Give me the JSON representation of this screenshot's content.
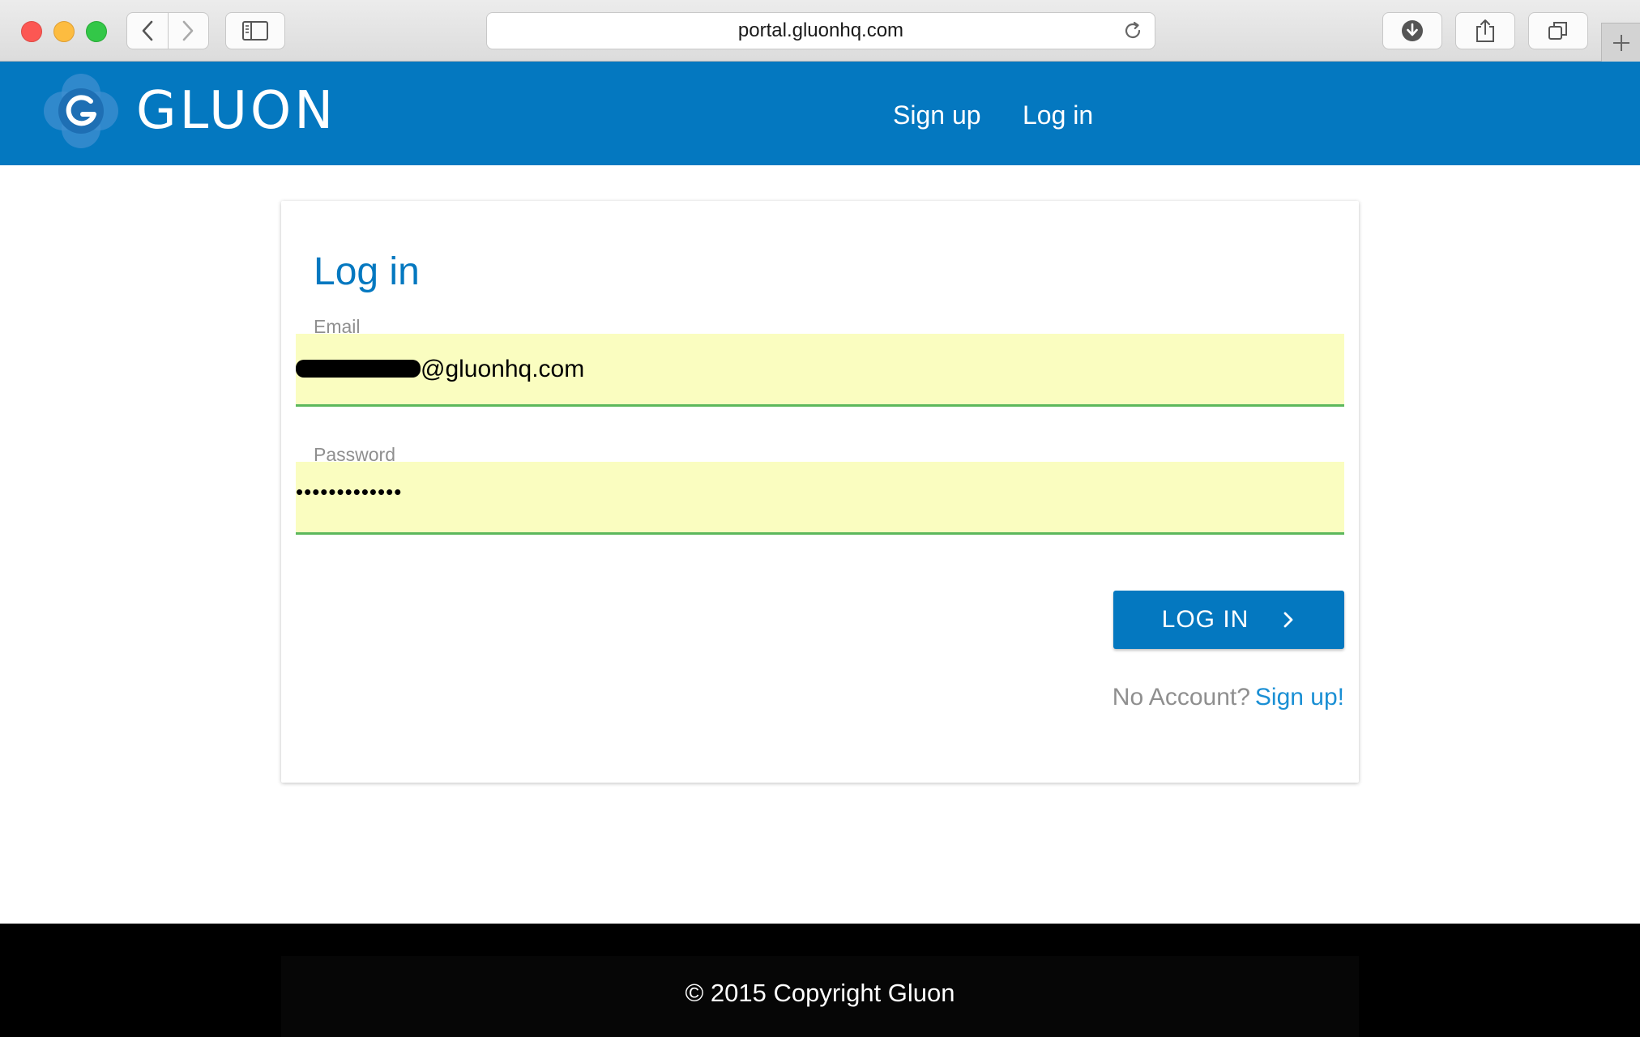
{
  "browser": {
    "url": "portal.gluonhq.com",
    "icons": {
      "back": "chevron-left-icon",
      "forward": "chevron-right-icon",
      "sidebar": "sidebar-icon",
      "reload": "reload-icon",
      "downloads": "download-icon",
      "share": "share-icon",
      "tabs": "tabs-icon",
      "new_tab": "plus-icon"
    }
  },
  "header": {
    "brand": "GLUON",
    "nav": {
      "signup": "Sign up",
      "login": "Log in"
    },
    "background_color": "#0478c0"
  },
  "form": {
    "title": "Log in",
    "email": {
      "label": "Email",
      "value_visible": "@gluonhq.com"
    },
    "password": {
      "label": "Password",
      "value_masked": "•••••••••••••"
    },
    "submit_label": "LOG IN",
    "no_account_text": "No Account?",
    "signup_link": "Sign up!",
    "accent_color": "#0478c0",
    "autofill_color": "#fafdc0",
    "valid_underline_color": "#5cb85c"
  },
  "footer": {
    "copyright": "© 2015 Copyright Gluon"
  }
}
